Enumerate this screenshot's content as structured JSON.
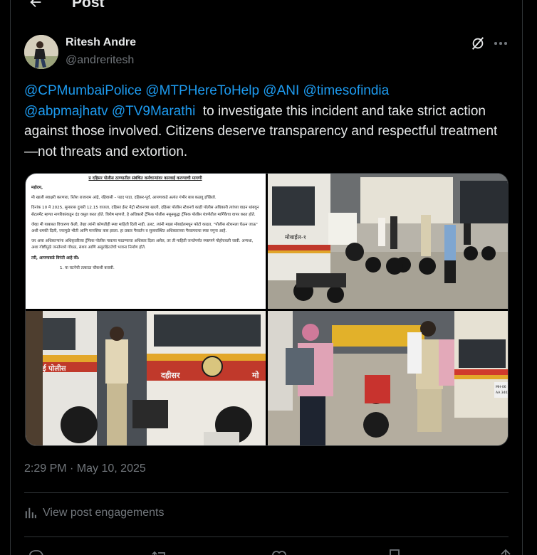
{
  "header": {
    "title": "Post",
    "back_icon": "arrow-left-icon"
  },
  "author": {
    "name": "Ritesh Andre",
    "handle": "@andreritesh"
  },
  "post": {
    "mentions_line1": [
      "@CPMumbaiPolice",
      "@MTPHereToHelp",
      "@ANI",
      "@timesofindia"
    ],
    "mentions_line2": [
      "@abpmajhatv",
      "@TV9Marathi"
    ],
    "text_after_mentions": "to investigate this incident and take strict action against those involved. Citizens deserve transparency and respectful treatment—not threats and extortion."
  },
  "media": {
    "document_heading": "प्र दहिसर पोलीस ठाण्यातील संबंधित कर्मचाऱ्यांवर कारवाई करण्याची मागणी",
    "document_lines": [
      "महोदय,",
      "मी खाली स्वाक्षरी करणारा, रितेश राजाराम आंद्रे, रहिवासी – पडद पाडा, दहिसर-पूर्व, आपणाकडे अत्यंत गंभीर बाब कळवू इच्छितो.",
      "दिनांक 10 मे 2025, सुमारास दुपारी 12.15 वाजता, दहिसर ईस्ट मेट्रो स्टेशनच्या खाली, दहिसर पोलीस स्टेशनचे काही पोलीस अधिकारी त्यांच्या वाहन थांबवून सेटलमेंट म्हणत नागरिकांकडून दंड वसूल करत होते. विशेष म्हणजे, हे अधिकारी ट्रॅफिक पोलीस नसूनसुद्धा ट्रॅफिक पोलीस यंत्रणेतील मार्गिकेचा वापर करत होते.",
      "जेव्हा मी याबाबत विचारणा केली, तेव्हा त्यांनी कोणतीही स्पष्ट माहिती दिली नाही. उलट, त्यांनी माझा मोबाईलमधून फोटो काढत, \"पोलीस स्टेशनला घेऊन जाऊ\" अशी धमकी दिली, ज्यामुळे भीती आणि मानसिक त्रास झाला. हा प्रकार गैरवर्तन व सुव्यवस्थित अधिकाराच्या गैरवापराचा स्पष्ट नमुना आहे.",
      "जर असा अधिकाऱ्यांना अधिकृतरित्या ट्रॅफिक पोलीस पावत्या फाडण्याचा अधिकार दिला असेल, तर ती माहिती जनतेपर्यंत स्पष्टपणे पोहोचवली जावी. अन्यथा, अशा गोष्टींमुळे जनतेमध्ये गोंधळ, संशय आणि असुरक्षिततेची भावना निर्माण होते.",
      "तरी, आपणाकडे विनंती आहे की:",
      "1.   या घटनेची तत्काळ चौकशी करावी."
    ],
    "van_label_mobile": "मोबाईल-१",
    "van_label_city": "मुंबई पोलीस",
    "van_label_station": "दहीसर",
    "van_label_station_suffix": "मो",
    "truck_badge": "MH-06\nAA 3403"
  },
  "meta": {
    "timestamp": "2:29 PM · May 10, 2025",
    "engagements_label": "View post engagements"
  },
  "colors": {
    "accent": "#1d9bf0",
    "muted": "#71767b",
    "text": "#e7e9ea",
    "border": "#2f3336",
    "background": "#000000"
  },
  "icons": {
    "grok": "grok-icon",
    "more": "more-icon",
    "analytics": "analytics-icon",
    "reply": "reply-icon",
    "repost": "repost-icon",
    "like": "like-icon",
    "bookmark": "bookmark-icon",
    "share": "share-icon"
  }
}
